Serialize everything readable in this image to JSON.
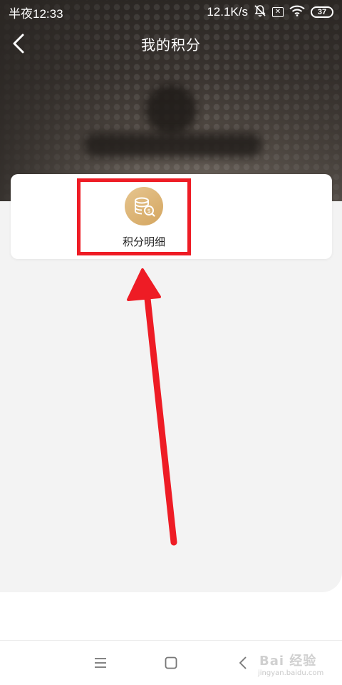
{
  "status_bar": {
    "time": "半夜12:33",
    "network_speed": "12.1K/s",
    "battery": "37",
    "icons": [
      "mute-bell-icon",
      "sim-off-icon",
      "wifi-icon",
      "battery-icon"
    ]
  },
  "header": {
    "title": "我的积分",
    "back_icon": "chevron-left-icon"
  },
  "card": {
    "items": [
      {
        "label": "积分明细",
        "icon": "coin-stack-search-icon"
      }
    ]
  },
  "annotation": {
    "highlight_color": "#ee1c25",
    "arrow_color": "#ee1c25"
  },
  "system_nav": {
    "buttons": [
      "menu-icon",
      "home-icon",
      "back-icon"
    ]
  },
  "watermark": {
    "brand": "Bai 经验",
    "url": "jingyan.baidu.com"
  },
  "colors": {
    "accent_gold": "#d9ae6c",
    "panel_gray": "#f3f3f3"
  }
}
